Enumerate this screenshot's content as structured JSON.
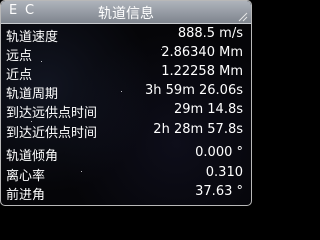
{
  "titlebar": {
    "button_e": "E",
    "button_c": "C",
    "title": "轨道信息"
  },
  "rows": [
    {
      "label": "轨道速度",
      "value": "888.5 m/s"
    },
    {
      "label": "远点",
      "value": "2.86340 Mm"
    },
    {
      "label": "近点",
      "value": "1.22258 Mm"
    },
    {
      "label": "轨道周期",
      "value": "3h 59m 26.06s"
    },
    {
      "label": "到达远供点时间",
      "value": "29m 14.8s"
    },
    {
      "label": "到达近供点时间",
      "value": "2h 28m 57.8s"
    },
    {
      "label": "轨道倾角",
      "value": "0.000 °"
    },
    {
      "label": "离心率",
      "value": "0.310"
    },
    {
      "label": "前进角",
      "value": "37.63 °"
    }
  ],
  "icons": {
    "resize": "resize-grip-icon"
  },
  "colors": {
    "titlebar": "#9aa0a8",
    "background": "#050508",
    "text": "#ffffff"
  }
}
